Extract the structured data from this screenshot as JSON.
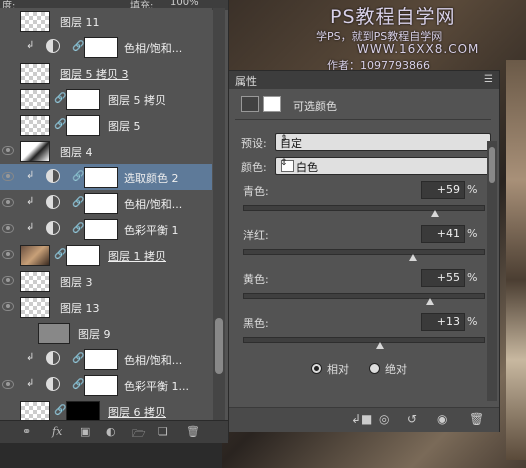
{
  "top_bar": {
    "opacity_label": "度:",
    "fill_label": "填充:",
    "fill_value": "100%"
  },
  "watermark": {
    "line1": "PS教程自学网",
    "line2": "学PS，就到PS教程自学网",
    "line3": "WWW.16XX8.COM",
    "line4": "作者：1097793866"
  },
  "layers": [
    {
      "name": "图层 11",
      "visible": false,
      "type": "pixel",
      "clipped": false,
      "underlined": false
    },
    {
      "name": "色相/饱和...",
      "visible": false,
      "type": "adjustment",
      "clipped": true,
      "underlined": false
    },
    {
      "name": "图层 5 拷贝 3",
      "visible": false,
      "type": "pixel",
      "clipped": false,
      "underlined": true
    },
    {
      "name": "图层 5 拷贝",
      "visible": false,
      "type": "masked",
      "clipped": false,
      "underlined": false
    },
    {
      "name": "图层 5",
      "visible": false,
      "type": "masked",
      "clipped": false,
      "underlined": false
    },
    {
      "name": "图层 4",
      "visible": true,
      "type": "pixel-dark",
      "clipped": false,
      "underlined": false
    },
    {
      "name": "选取颜色 2",
      "visible": true,
      "type": "adjustment",
      "clipped": true,
      "underlined": false,
      "selected": true
    },
    {
      "name": "色相/饱和...",
      "visible": true,
      "type": "adjustment",
      "clipped": true,
      "underlined": false
    },
    {
      "name": "色彩平衡 1",
      "visible": true,
      "type": "adjustment",
      "clipped": true,
      "underlined": false
    },
    {
      "name": "图层 1 拷贝",
      "visible": true,
      "type": "photo-masked",
      "clipped": false,
      "underlined": true
    },
    {
      "name": "图层 3",
      "visible": true,
      "type": "pixel",
      "clipped": false,
      "underlined": false
    },
    {
      "name": "图层 13",
      "visible": true,
      "type": "pixel",
      "clipped": false,
      "underlined": false
    },
    {
      "name": "图层 9",
      "visible": false,
      "type": "gray",
      "clipped": false,
      "underlined": false
    },
    {
      "name": "色相/饱和...",
      "visible": false,
      "type": "adjustment",
      "clipped": true,
      "underlined": false
    },
    {
      "name": "色彩平衡 1...",
      "visible": true,
      "type": "adjustment",
      "clipped": true,
      "underlined": false
    },
    {
      "name": "图层 6 拷贝",
      "visible": false,
      "type": "black-mask",
      "clipped": false,
      "underlined": true
    }
  ],
  "layer_icons": {
    "link": "link-icon",
    "fx": "fx",
    "mask": "mask-icon",
    "adjust": "adjustment-icon",
    "group": "folder-icon",
    "new": "new-layer-icon",
    "delete": "trash-icon"
  },
  "properties": {
    "tab": "属性",
    "title": "可选颜色",
    "preset_label": "预设:",
    "preset_value": "自定",
    "color_label": "颜色:",
    "color_value": "白色",
    "sliders": [
      {
        "label": "青色:",
        "value": "+59",
        "unit": "%",
        "amount": 59
      },
      {
        "label": "洋红:",
        "value": "+41",
        "unit": "%",
        "amount": 41
      },
      {
        "label": "黄色:",
        "value": "+55",
        "unit": "%",
        "amount": 55
      },
      {
        "label": "黑色:",
        "value": "+13",
        "unit": "%",
        "amount": 13
      }
    ],
    "method_relative": "相对",
    "method_absolute": "绝对",
    "method_selected": "relative"
  }
}
